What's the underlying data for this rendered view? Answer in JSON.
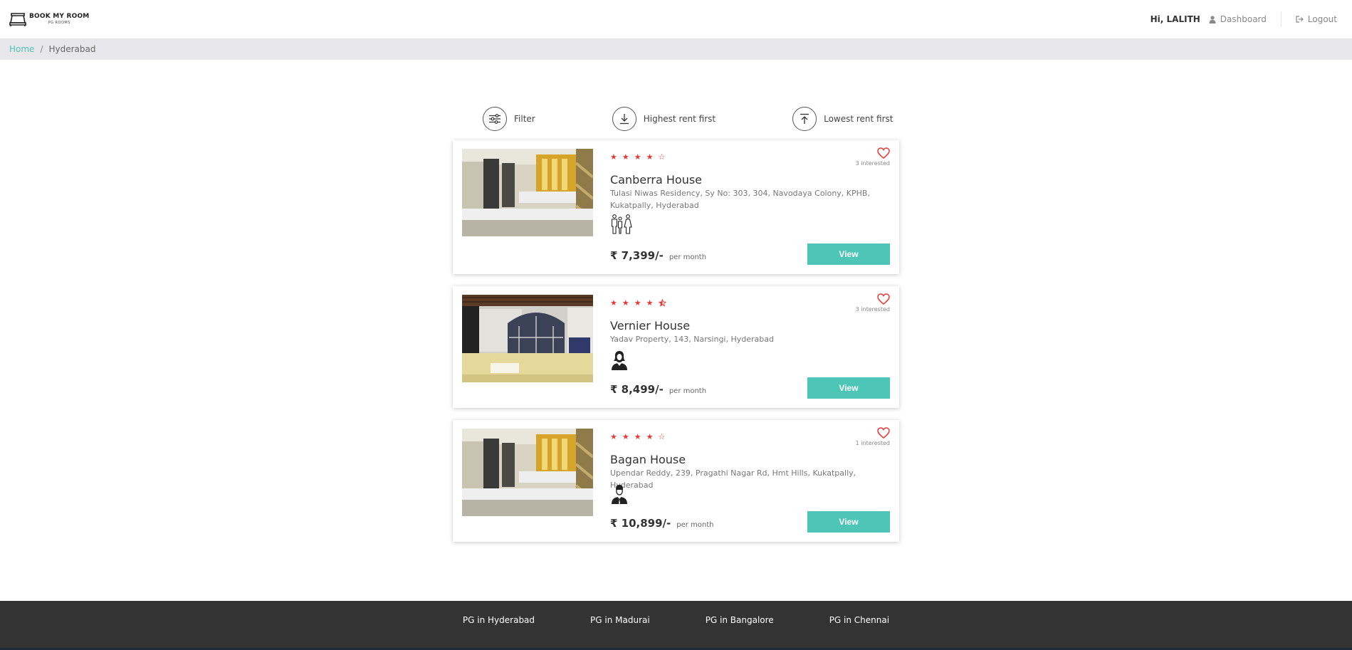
{
  "header": {
    "logo_main": "BOOK MY ROOM",
    "logo_sub": "PG ROOMS",
    "greeting": "Hi, LALITH",
    "dashboard_label": "Dashboard",
    "logout_label": "Logout"
  },
  "breadcrumb": {
    "home": "Home",
    "separator": "/",
    "current": "Hyderabad"
  },
  "sort": {
    "filter_label": "Filter",
    "highest_label": "Highest rent first",
    "lowest_label": "Lowest rent first"
  },
  "colors": {
    "accent": "#4dc6b8",
    "star": "#e53935",
    "heart": "#e53935",
    "footer_bg": "#333333",
    "breadcrumb_bg": "#e8e8ec"
  },
  "listings": [
    {
      "rating": 4,
      "rating_icons": [
        "star-full",
        "star-full",
        "star-full",
        "star-full",
        "star-empty"
      ],
      "interested": "3 interested",
      "title": "Canberra House",
      "address": "Tulasi Niwas Residency, Sy No: 303, 304, Navodaya Colony, KPHB, Kukatpally, Hyderabad",
      "gender_icon": "co-living-icon",
      "price": "₹ 7,399/-",
      "price_unit": "per month",
      "view_label": "View"
    },
    {
      "rating": 4.5,
      "rating_icons": [
        "star-full",
        "star-full",
        "star-full",
        "star-full",
        "star-half"
      ],
      "interested": "3 interested",
      "title": "Vernier House",
      "address": "Yadav Property, 143, Narsingi, Hyderabad",
      "gender_icon": "female-icon",
      "price": "₹ 8,499/-",
      "price_unit": "per month",
      "view_label": "View"
    },
    {
      "rating": 4,
      "rating_icons": [
        "star-full",
        "star-full",
        "star-full",
        "star-full",
        "star-empty"
      ],
      "interested": "1 interested",
      "title": "Bagan House",
      "address": "Upendar Reddy, 239, Pragathi Nagar Rd, Hmt Hills, Kukatpally, Hyderabad",
      "gender_icon": "male-icon",
      "price": "₹ 10,899/-",
      "price_unit": "per month",
      "view_label": "View"
    }
  ],
  "footer": {
    "links": [
      "PG in Hyderabad",
      "PG in Madurai",
      "PG in Bangalore",
      "PG in Chennai"
    ]
  }
}
